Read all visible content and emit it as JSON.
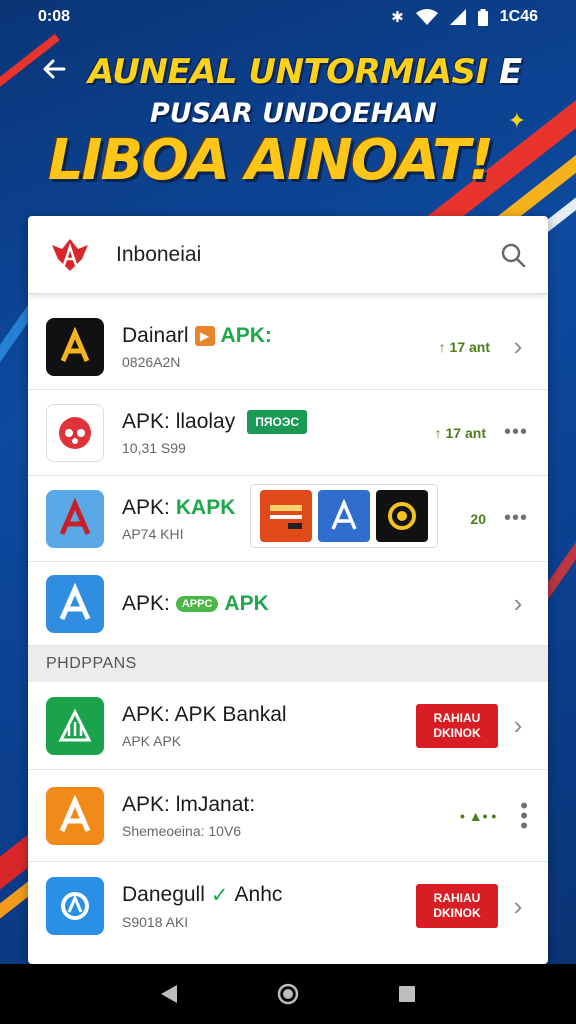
{
  "status_bar": {
    "time": "0:08",
    "clock_right": "1C46",
    "icons": [
      "bluetooth-icon",
      "wifi-icon",
      "signal-icon",
      "battery-icon"
    ]
  },
  "header": {
    "line1": "AUNEAL UNTORMIASI",
    "line1_end": "E",
    "line2": "PUSAR UNDOEHAN",
    "line3": "LIBOA AINOAT!"
  },
  "search": {
    "text": "Inboneiai"
  },
  "apps": [
    {
      "title": "Dainarl",
      "tag": "APK:",
      "sub": "0826A2N",
      "rating": "↑ 17 ant",
      "action": "chevron"
    },
    {
      "title": "APK: llaolay",
      "chip": "ПЯОЭС",
      "sub": "10,31 S99",
      "rating": "↑ 17 ant",
      "action": "dots"
    },
    {
      "title": "APK: ",
      "tag": "KAPK",
      "sub": "AP74 KHI",
      "rating": "20",
      "action": "dots"
    },
    {
      "title": "APK: ",
      "pill": "APPC",
      "tag": "APK",
      "sub": "",
      "action": "chevron"
    }
  ],
  "section_label": "PHDPPANS",
  "apps2": [
    {
      "title": "APK: APK Bankal",
      "sub": "APK APK",
      "button_line1": "RAHIAU",
      "button_line2": "DKINOK",
      "action": "chevron"
    },
    {
      "title": "APK: lmJanat:",
      "sub": "Shemeoeina: 10V6",
      "rating": "• ▲• •",
      "action": "vdots"
    },
    {
      "title": "Danegull",
      "tag": "Anhc",
      "sub": "S9018 AKI",
      "button_line1": "RAHIAU",
      "button_line2": "DKINOK",
      "action": "chevron"
    }
  ],
  "colors": {
    "accent_yellow": "#ffc61a",
    "accent_red": "#d81e24",
    "accent_green": "#1ea84a",
    "background_blue": "#0c3e86"
  }
}
